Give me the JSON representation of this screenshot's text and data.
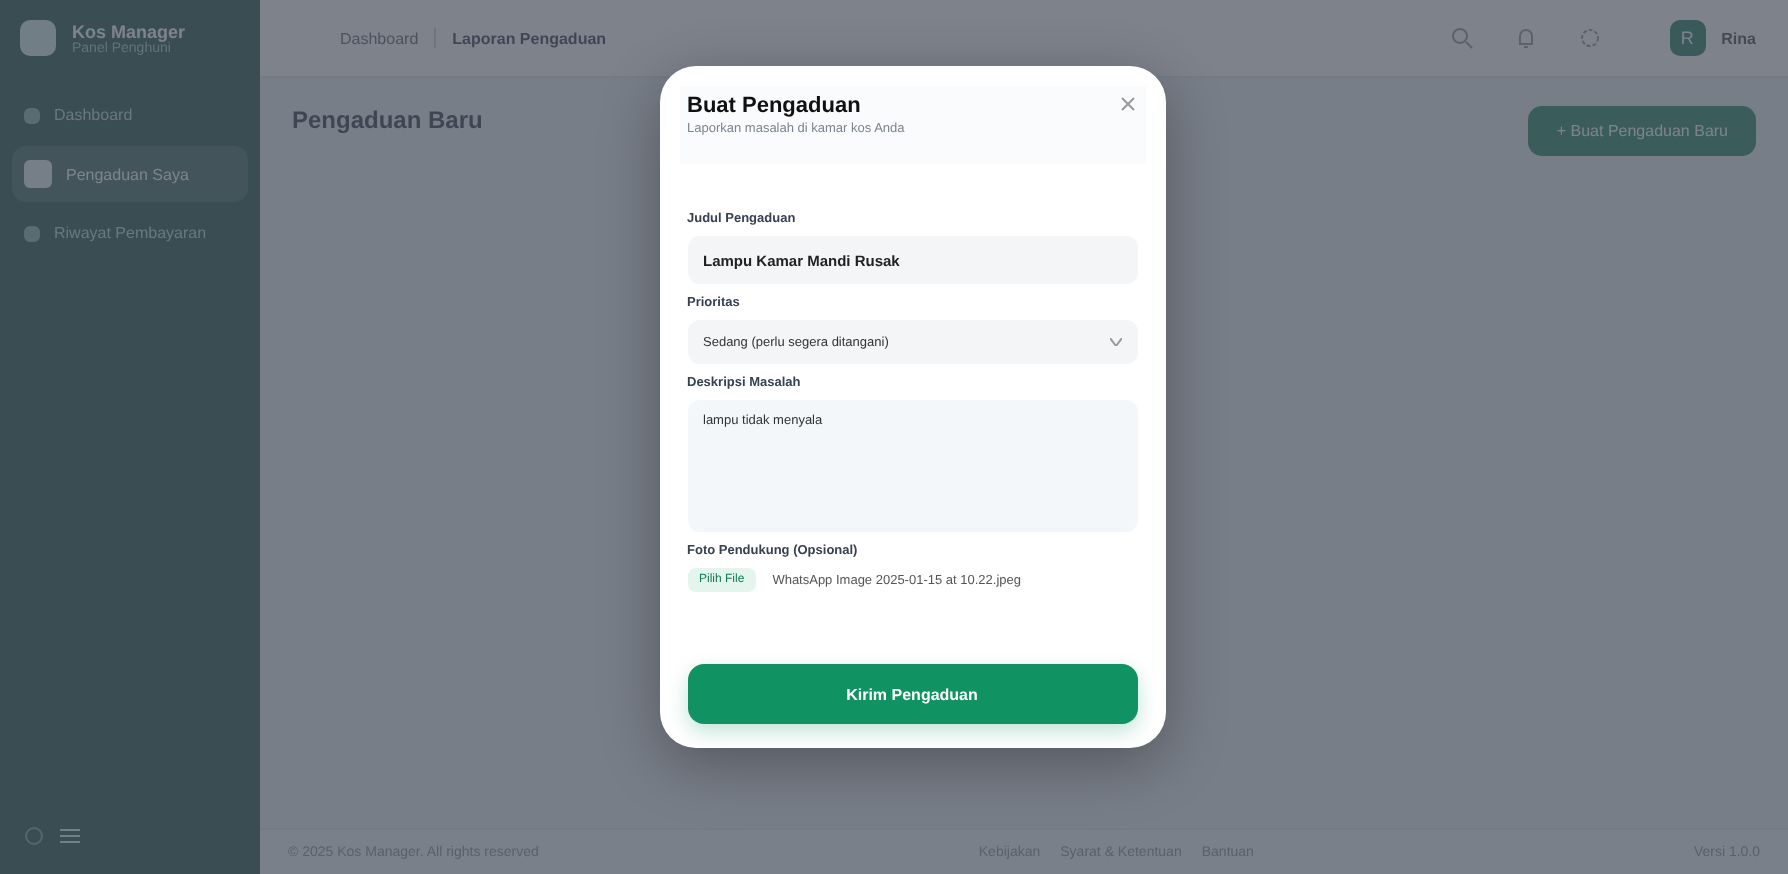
{
  "brand": {
    "name": "Kos Manager",
    "tagline": "Panel Penghuni"
  },
  "sidebar": {
    "items": [
      {
        "label": "Dashboard",
        "selected": false
      },
      {
        "label": "Pengaduan Saya",
        "selected": true
      },
      {
        "label": "Riwayat Pembayaran",
        "selected": false
      }
    ]
  },
  "header": {
    "breadcrumb": [
      "Dashboard",
      "Laporan Pengaduan"
    ],
    "user": {
      "initial": "R",
      "name": "Rina"
    }
  },
  "page": {
    "title": "Pengaduan Baru",
    "new_button": "+ Buat Pengaduan Baru"
  },
  "modal": {
    "title": "Buat Pengaduan",
    "subtitle": "Laporkan masalah di kamar kos Anda",
    "fields": [
      {
        "kind": "text",
        "label": "Judul Pengaduan",
        "value": "Lampu Kamar Mandi Rusak"
      },
      {
        "kind": "select",
        "label": "Prioritas",
        "value": "Sedang (perlu segera ditangani)"
      },
      {
        "kind": "textarea",
        "label": "Deskripsi Masalah",
        "value": "lampu tidak menyala"
      },
      {
        "kind": "file",
        "label": "Foto Pendukung (Opsional)",
        "button": "Pilih File",
        "value": "WhatsApp Image 2025-01-15 at 10.22.jpeg"
      }
    ],
    "submit": "Kirim Pengaduan"
  },
  "footer": {
    "copyright": "© 2025 Kos Manager. All rights reserved",
    "links": [
      "Kebijakan",
      "Syarat & Ketentuan",
      "Bantuan"
    ],
    "version": "Versi 1.0.0"
  }
}
